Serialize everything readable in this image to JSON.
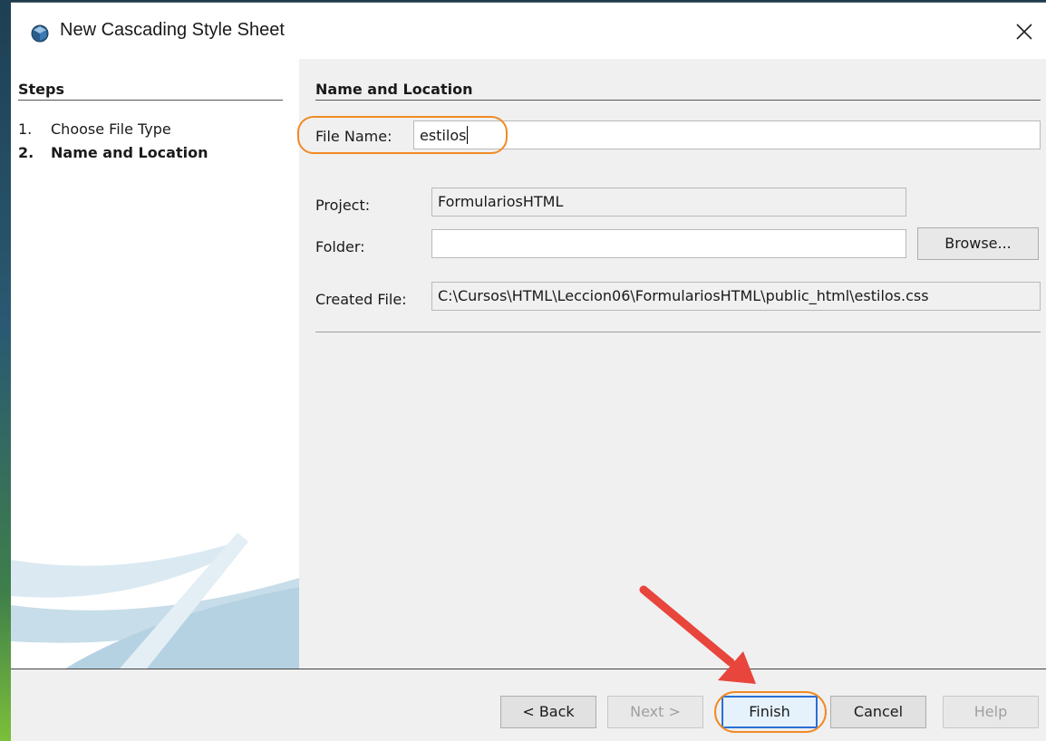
{
  "window": {
    "title": "New Cascading Style Sheet",
    "close_glyph": "✕"
  },
  "steps": {
    "heading": "Steps",
    "items": [
      {
        "num": "1.",
        "label": "Choose File Type",
        "active": false
      },
      {
        "num": "2.",
        "label": "Name and Location",
        "active": true
      }
    ]
  },
  "form": {
    "heading": "Name and Location",
    "file_name_label": "File Name:",
    "file_name_value": "estilos",
    "project_label": "Project:",
    "project_value": "FormulariosHTML",
    "folder_label": "Folder:",
    "folder_value": "",
    "browse_label": "Browse...",
    "created_file_label": "Created File:",
    "created_file_value": "C:\\Cursos\\HTML\\Leccion06\\FormulariosHTML\\public_html\\estilos.css"
  },
  "buttons": {
    "back": "< Back",
    "next": "Next >",
    "finish": "Finish",
    "cancel": "Cancel",
    "help": "Help"
  },
  "colors": {
    "highlight": "#f08a24",
    "arrow": "#e8453c",
    "default_button_border": "#2a6fd6"
  },
  "icons": {
    "title_icon": "netbeans-cube-icon",
    "close_icon": "close-icon"
  }
}
